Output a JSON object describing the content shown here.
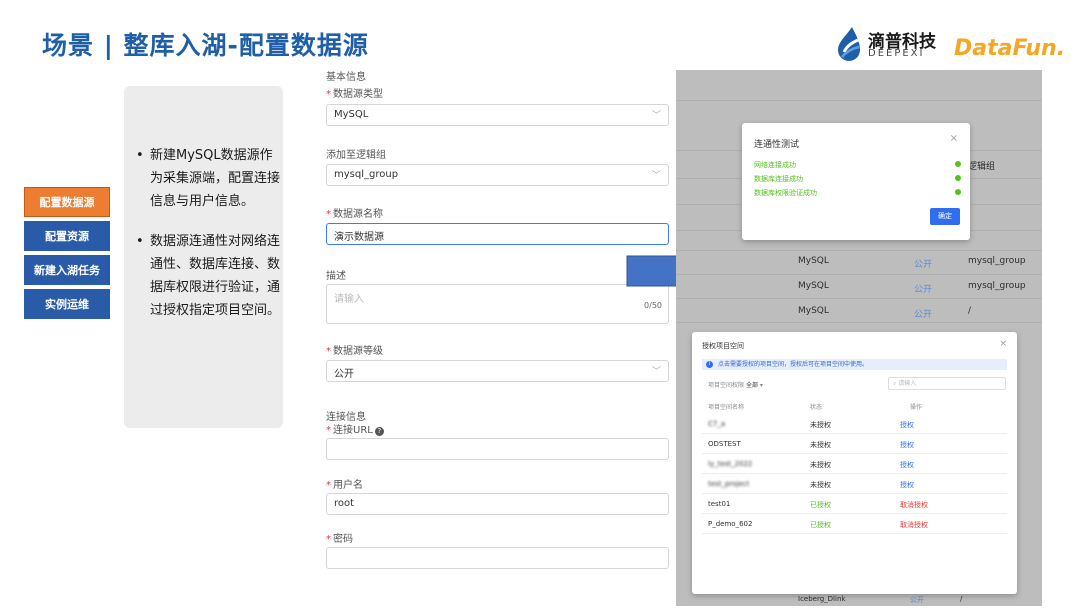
{
  "title": "场景 | 整库入湖-配置数据源",
  "logos": {
    "deepexi_cn": "滴普科技",
    "deepexi_en": "DEEPEXI",
    "datafun": "DataFun."
  },
  "nav": [
    "配置数据源",
    "配置资源",
    "新建入湖任务",
    "实例运维"
  ],
  "bullets": [
    "新建MySQL数据源作为采集源端，配置连接信息与用户信息。",
    "数据源连通性对网络连通性、数据库连接、数据库权限进行验证，通过授权指定项目空间。"
  ],
  "form": {
    "section_basic": "基本信息",
    "type_label": "数据源类型",
    "type_value": "MySQL",
    "group_label": "添加至逻辑组",
    "group_value": "mysql_group",
    "name_label": "数据源名称",
    "name_value": "演示数据源",
    "desc_label": "描述",
    "desc_placeholder": "请输入",
    "desc_counter": "0/50",
    "level_label": "数据源等级",
    "level_value": "公开",
    "section_conn": "连接信息",
    "url_label": "连接URL",
    "user_label": "用户名",
    "user_value": "root",
    "pwd_label": "密码"
  },
  "bg_table": {
    "header_tail": "逻辑组",
    "rows": [
      {
        "type": "MySQL",
        "level": "公开",
        "group": "mysql_group"
      },
      {
        "type": "MySQL",
        "level": "公开",
        "group": "mysql_group"
      },
      {
        "type": "MySQL",
        "level": "公开",
        "group": "/"
      }
    ],
    "last_row": {
      "type": "Iceberg_Dlink",
      "level": "公开",
      "group": "/"
    }
  },
  "test_dialog": {
    "title": "连通性测试",
    "close": "×",
    "checks": [
      "网络连接成功",
      "数据库连接成功",
      "数据库权限验证成功"
    ],
    "confirm": "确定"
  },
  "auth_dialog": {
    "title": "授权项目空间",
    "close": "×",
    "info": "点击需要授权的项目空间，授权后可在项目空间中使用。",
    "filter_label": "项目空间权限",
    "filter_value": "全部",
    "search_placeholder": "请输入",
    "headers": [
      "项目空间名称",
      "状态",
      "操作"
    ],
    "rows": [
      {
        "name": "C7_a",
        "status": "未授权",
        "action": "授权",
        "blur": true
      },
      {
        "name": "ODSTEST",
        "status": "未授权",
        "action": "授权",
        "blur": false
      },
      {
        "name": "ly_test_2022",
        "status": "未授权",
        "action": "授权",
        "blur": true
      },
      {
        "name": "test_project",
        "status": "未授权",
        "action": "授权",
        "blur": true
      },
      {
        "name": "test01",
        "status": "已授权",
        "action": "取消授权",
        "blur": false
      },
      {
        "name": "P_demo_602",
        "status": "已授权",
        "action": "取消授权",
        "blur": false
      }
    ]
  }
}
